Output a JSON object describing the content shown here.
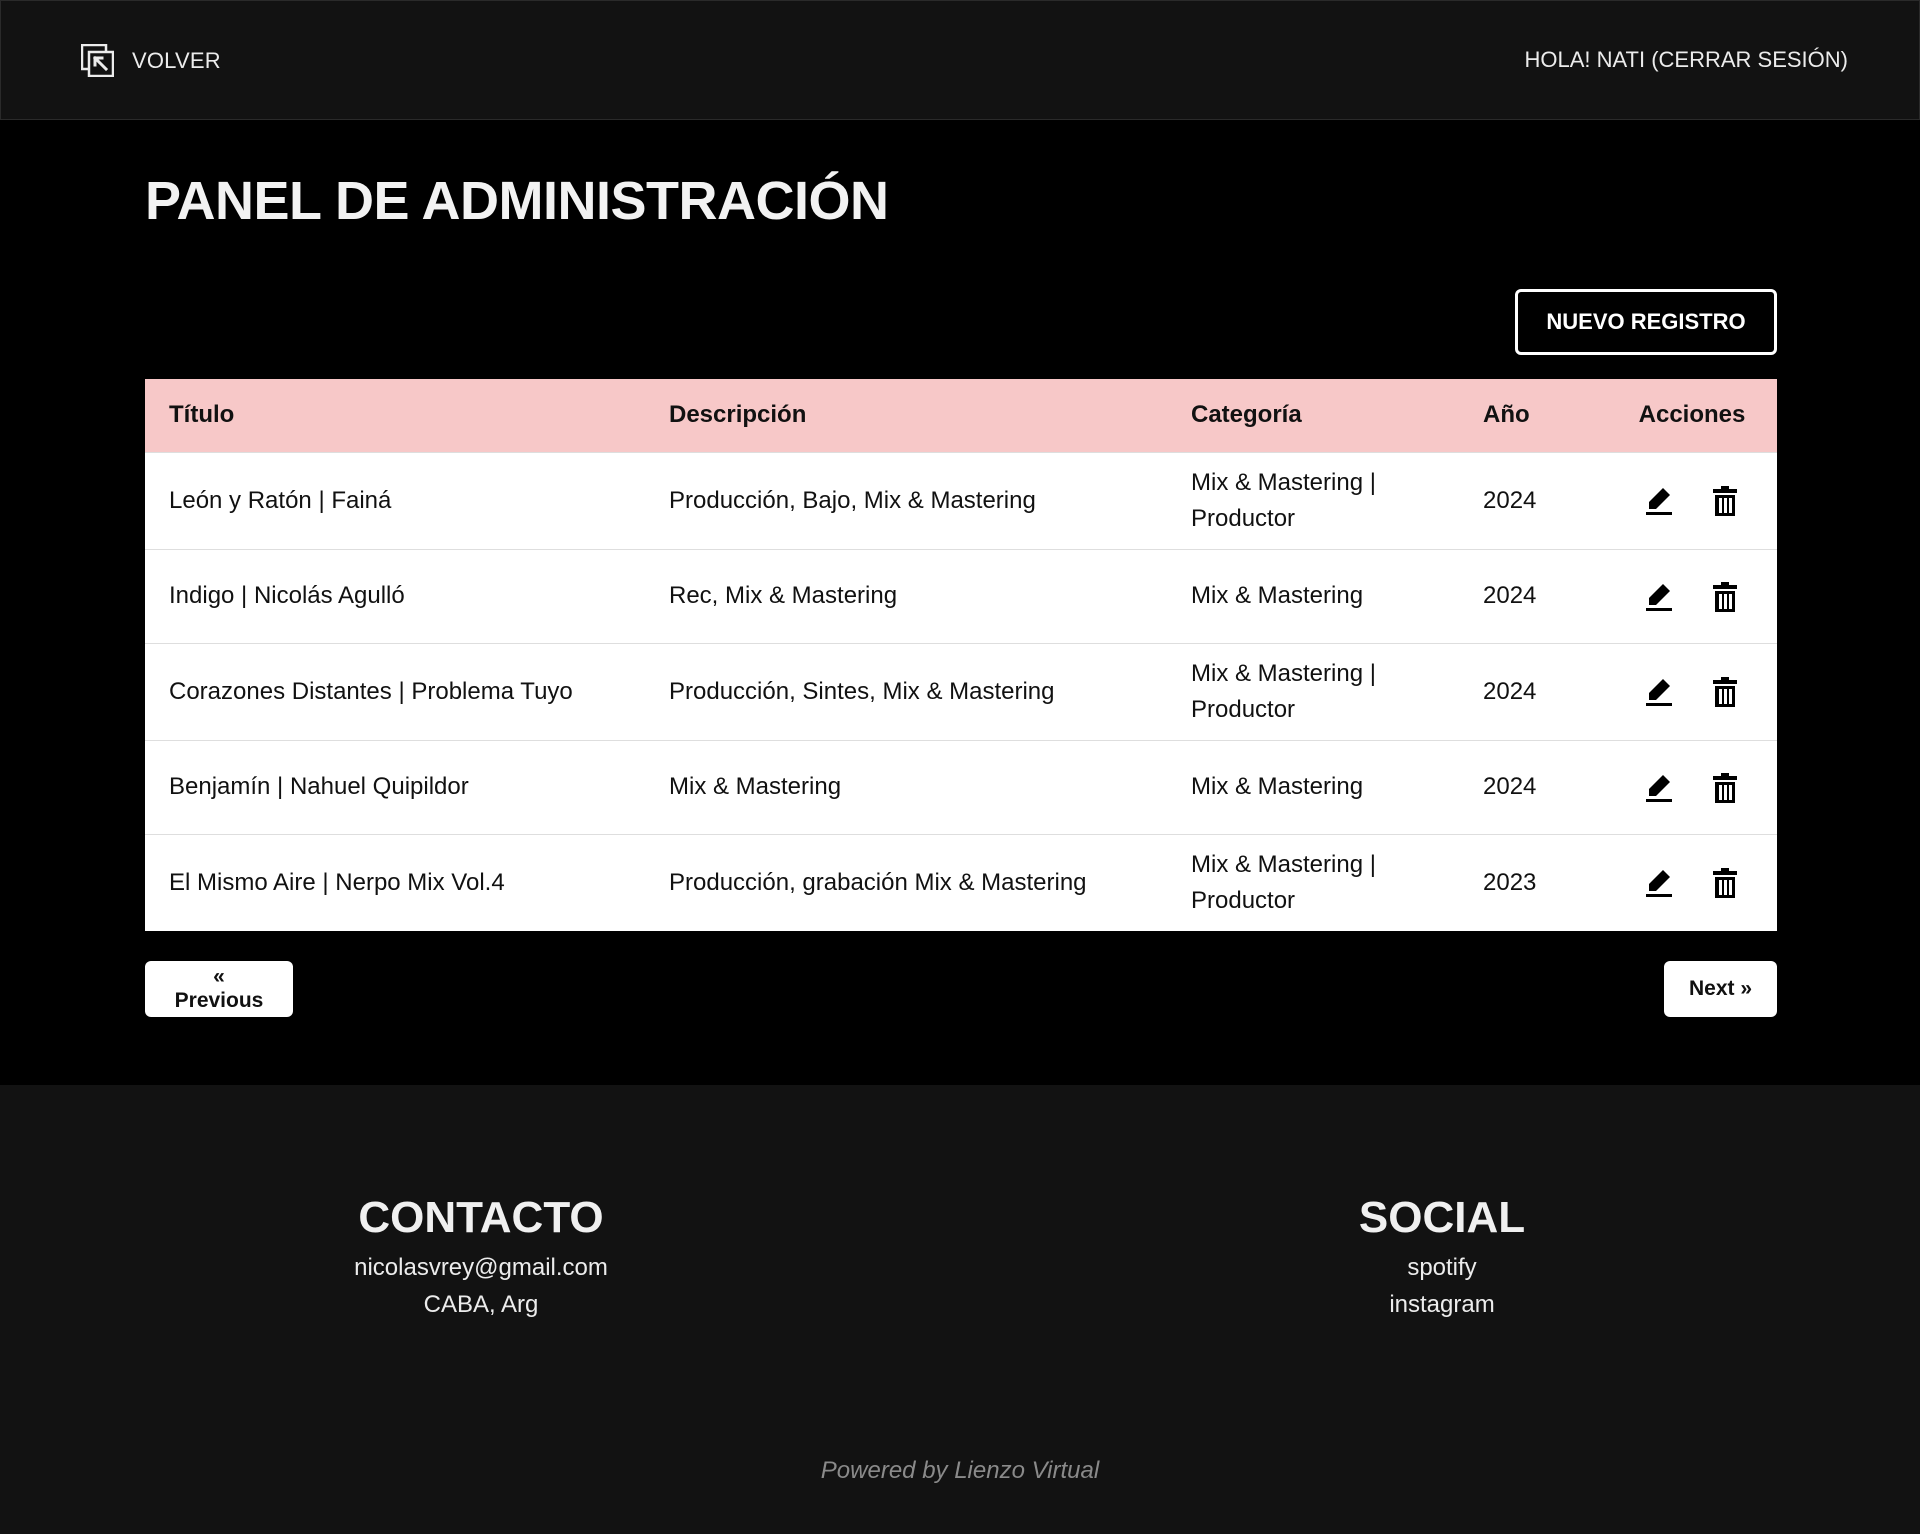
{
  "header": {
    "back_label": "VOLVER",
    "greeting": "HOLA! NATI",
    "logout_label": "(CERRAR SESIÓN)"
  },
  "page": {
    "title": "PANEL DE ADMINISTRACIÓN",
    "new_record_label": "NUEVO REGISTRO"
  },
  "table": {
    "columns": [
      "Título",
      "Descripción",
      "Categoría",
      "Año",
      "Acciones"
    ],
    "rows": [
      {
        "title": "León y Ratón | Fainá",
        "description": "Producción, Bajo, Mix & Mastering",
        "category": "Mix & Mastering | Productor",
        "year": "2024"
      },
      {
        "title": "Indigo | Nicolás Agulló",
        "description": "Rec, Mix & Mastering",
        "category": "Mix & Mastering",
        "year": "2024"
      },
      {
        "title": "Corazones Distantes | Problema Tuyo",
        "description": "Producción, Sintes, Mix & Mastering",
        "category": "Mix & Mastering | Productor",
        "year": "2024"
      },
      {
        "title": "Benjamín | Nahuel Quipildor",
        "description": "Mix & Mastering",
        "category": "Mix & Mastering",
        "year": "2024"
      },
      {
        "title": "El Mismo Aire | Nerpo Mix Vol.4",
        "description": "Producción, grabación Mix & Mastering",
        "category": "Mix & Mastering | Productor",
        "year": "2023"
      }
    ],
    "row_action_icons": [
      "pencil-icon",
      "trash-icon"
    ]
  },
  "pagination": {
    "previous_label": "« Previous",
    "next_label": "Next »"
  },
  "footer": {
    "contact_heading": "CONTACTO",
    "email": "nicolasvrey@gmail.com",
    "location": "CABA, Arg",
    "social_heading": "SOCIAL",
    "social_links": [
      "spotify",
      "instagram"
    ],
    "powered_by": "Powered by Lienzo Virtual"
  },
  "colors": {
    "page_background": "#000000",
    "bar_background": "#121212",
    "table_header": "#f7c8c8",
    "text_light": "#ececec"
  }
}
